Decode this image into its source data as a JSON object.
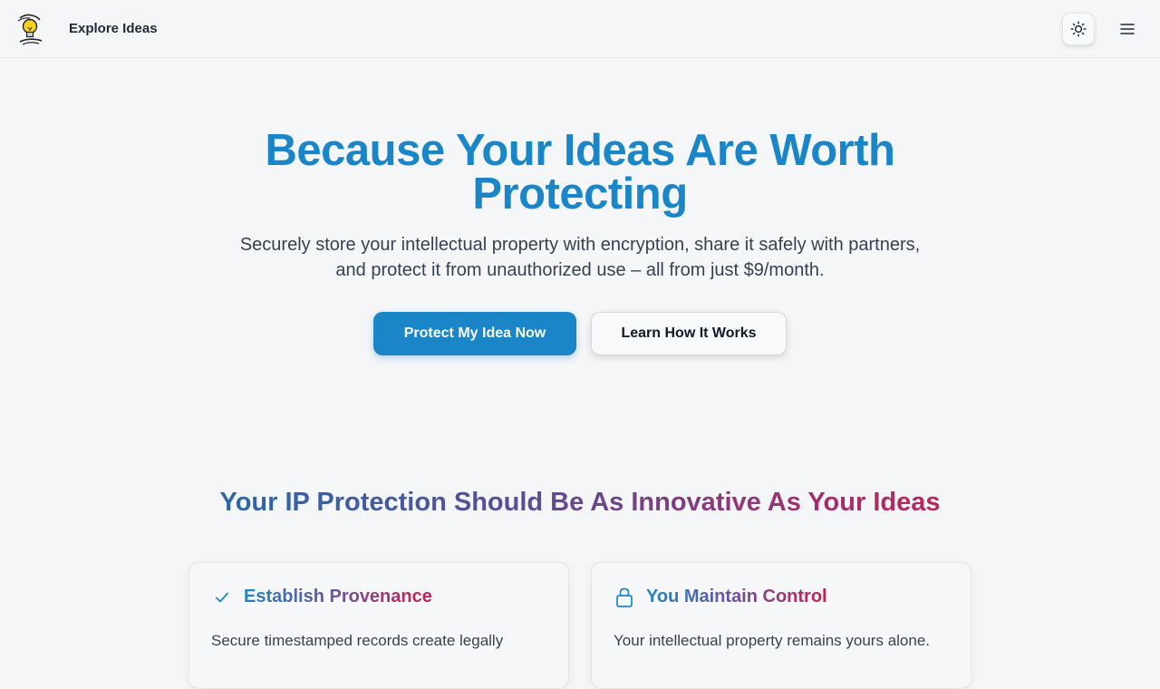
{
  "header": {
    "logo_icon": "lightbulb-logo-icon",
    "nav_link": "Explore Ideas",
    "theme_toggle_icon": "sun-icon",
    "menu_icon": "hamburger-menu-icon"
  },
  "hero": {
    "title": "Because Your Ideas Are Worth Protecting",
    "subtitle": "Securely store your intellectual property with encryption, share it safely with partners, and protect it from unauthorized use – all from just $9/month.",
    "primary_button": "Protect My Idea Now",
    "secondary_button": "Learn How It Works"
  },
  "features": {
    "title": "Your IP Protection Should Be As Innovative As Your Ideas",
    "cards": [
      {
        "icon": "checkmark-icon",
        "title": "Establish Provenance",
        "text": "Secure timestamped records create legally"
      },
      {
        "icon": "lock-icon",
        "title": "You Maintain Control",
        "text": "Your intellectual property remains yours alone."
      }
    ]
  },
  "colors": {
    "brand_blue": "#1a86c8",
    "gradient_start": "#1f6fae",
    "gradient_end": "#c8214f",
    "background": "#f4f6f8"
  }
}
